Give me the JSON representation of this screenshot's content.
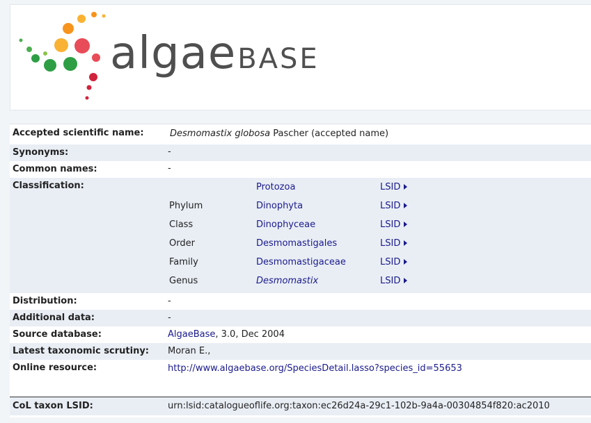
{
  "logo": {
    "word_main": "algae",
    "word_second": "BASE",
    "dot_colors": [
      "#f7941d",
      "#f9b233",
      "#e84c59",
      "#d0233c",
      "#4caf50",
      "#2e9e45",
      "#8bc34a"
    ]
  },
  "fields": {
    "accepted_label": "Accepted scientific name:",
    "accepted_genus_species": "Desmomastix globosa",
    "accepted_author": " Pascher (accepted name)",
    "synonyms_label": "Synonyms:",
    "synonyms_value": "-",
    "common_label": "Common names:",
    "common_value": "-",
    "classification_label": "Classification:",
    "distribution_label": "Distribution:",
    "distribution_value": "-",
    "additional_label": "Additional data:",
    "additional_value": "-",
    "source_label": "Source database:",
    "source_link": "AlgaeBase",
    "source_rest": ", 3.0, Dec 2004",
    "scrutiny_label": "Latest taxonomic scrutiny:",
    "scrutiny_value": "Moran E.,",
    "online_label": "Online resource:",
    "online_link": "http://www.algaebase.org/SpeciesDetail.lasso?species_id=55653",
    "col_label": "CoL taxon LSID:",
    "col_value": "urn:lsid:catalogueoflife.org:taxon:ec26d24a-29c1-102b-9a4a-00304854f820:ac2010"
  },
  "classification": [
    {
      "rank": "",
      "name": "Protozoa",
      "lsid": "LSID"
    },
    {
      "rank": "Phylum",
      "name": "Dinophyta",
      "lsid": "LSID"
    },
    {
      "rank": "Class",
      "name": "Dinophyceae",
      "lsid": "LSID"
    },
    {
      "rank": "Order",
      "name": "Desmomastigales",
      "lsid": "LSID"
    },
    {
      "rank": "Family",
      "name": "Desmomastigaceae",
      "lsid": "LSID"
    },
    {
      "rank": "Genus",
      "name": "Desmomastix",
      "lsid": "LSID"
    }
  ]
}
